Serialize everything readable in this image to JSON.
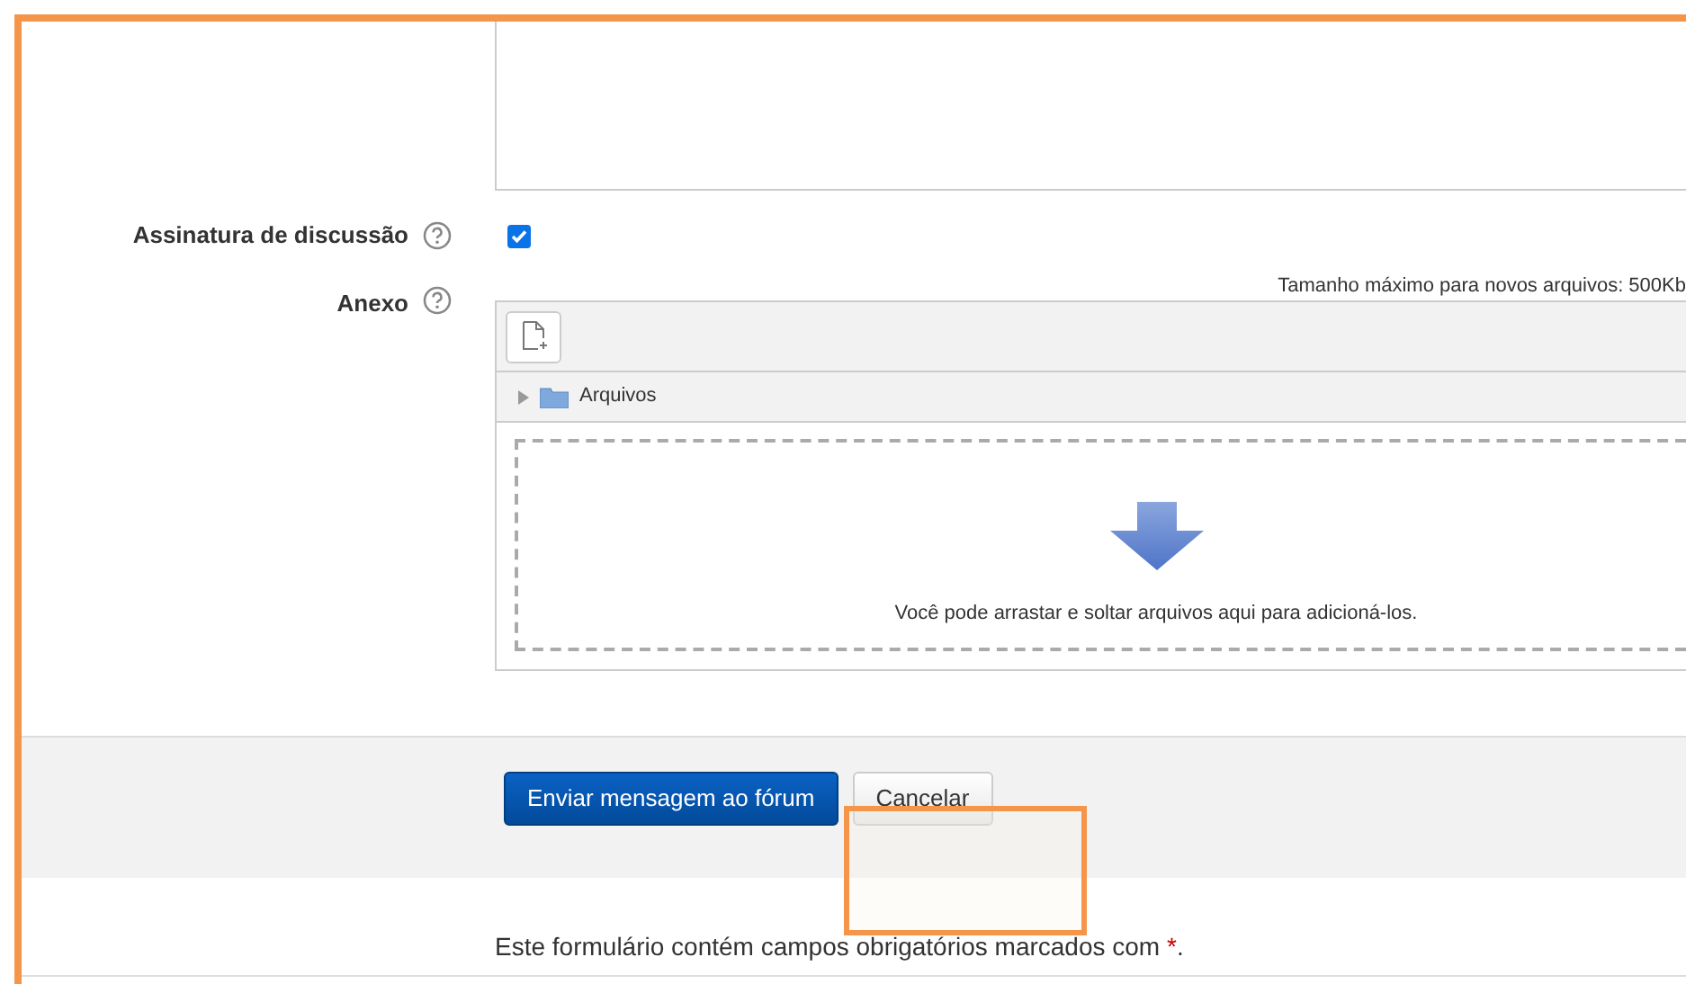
{
  "form": {
    "signature": {
      "label": "Assinatura de discussão",
      "checked": true
    },
    "attachment": {
      "label": "Anexo",
      "max_size": "Tamanho máximo para novos arquivos: 500Kb",
      "folder": "Arquivos",
      "drop_hint": "Você pode arrastar e soltar arquivos aqui para adicioná-los."
    },
    "buttons": [
      {
        "label": "Enviar mensagem ao fórum",
        "kind": "primary"
      },
      {
        "label": "Cancelar",
        "kind": "secondary"
      }
    ],
    "required_note": "Este formulário contém campos obrigatórios marcados com ",
    "required_mark": "*",
    "required_end": "."
  }
}
